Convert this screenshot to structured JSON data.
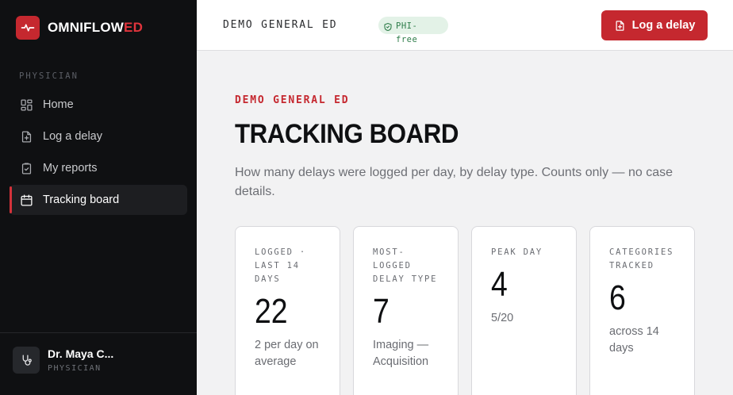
{
  "brand": {
    "name_main": "OMNIFLOW",
    "name_accent": "ED"
  },
  "sidebar": {
    "section_label": "PHYSICIAN",
    "items": [
      {
        "label": "Home",
        "icon": "dashboard-icon",
        "active": false
      },
      {
        "label": "Log a delay",
        "icon": "file-plus-icon",
        "active": false
      },
      {
        "label": "My reports",
        "icon": "clipboard-check-icon",
        "active": false
      },
      {
        "label": "Tracking board",
        "icon": "calendar-icon",
        "active": true
      }
    ],
    "user": {
      "name": "Dr. Maya C...",
      "role": "PHYSICIAN",
      "icon": "stethoscope-icon"
    }
  },
  "topbar": {
    "unit": "DEMO GENERAL ED",
    "badge": {
      "label": "PHI-free",
      "icon": "shield-check-icon"
    },
    "log_button": {
      "label": "Log a delay",
      "icon": "file-plus-icon"
    }
  },
  "main": {
    "eyebrow": "DEMO GENERAL ED",
    "title": "TRACKING BOARD",
    "subtitle": "How many delays were logged per day, by delay type. Counts only — no case details.",
    "stats": [
      {
        "label": "Logged · last 14 days",
        "value": "22",
        "note": "2 per day on average"
      },
      {
        "label": "Most-logged delay type",
        "value": "7",
        "note": "Imaging — Acquisition"
      },
      {
        "label": "Peak day",
        "value": "4",
        "note": "5/20"
      },
      {
        "label": "Categories tracked",
        "value": "6",
        "note": "across 14 days"
      }
    ]
  },
  "colors": {
    "accent": "#c5282f",
    "sidebar_bg": "#0f1012",
    "badge_bg": "#e3f2e7",
    "badge_text": "#2e7d4a"
  }
}
